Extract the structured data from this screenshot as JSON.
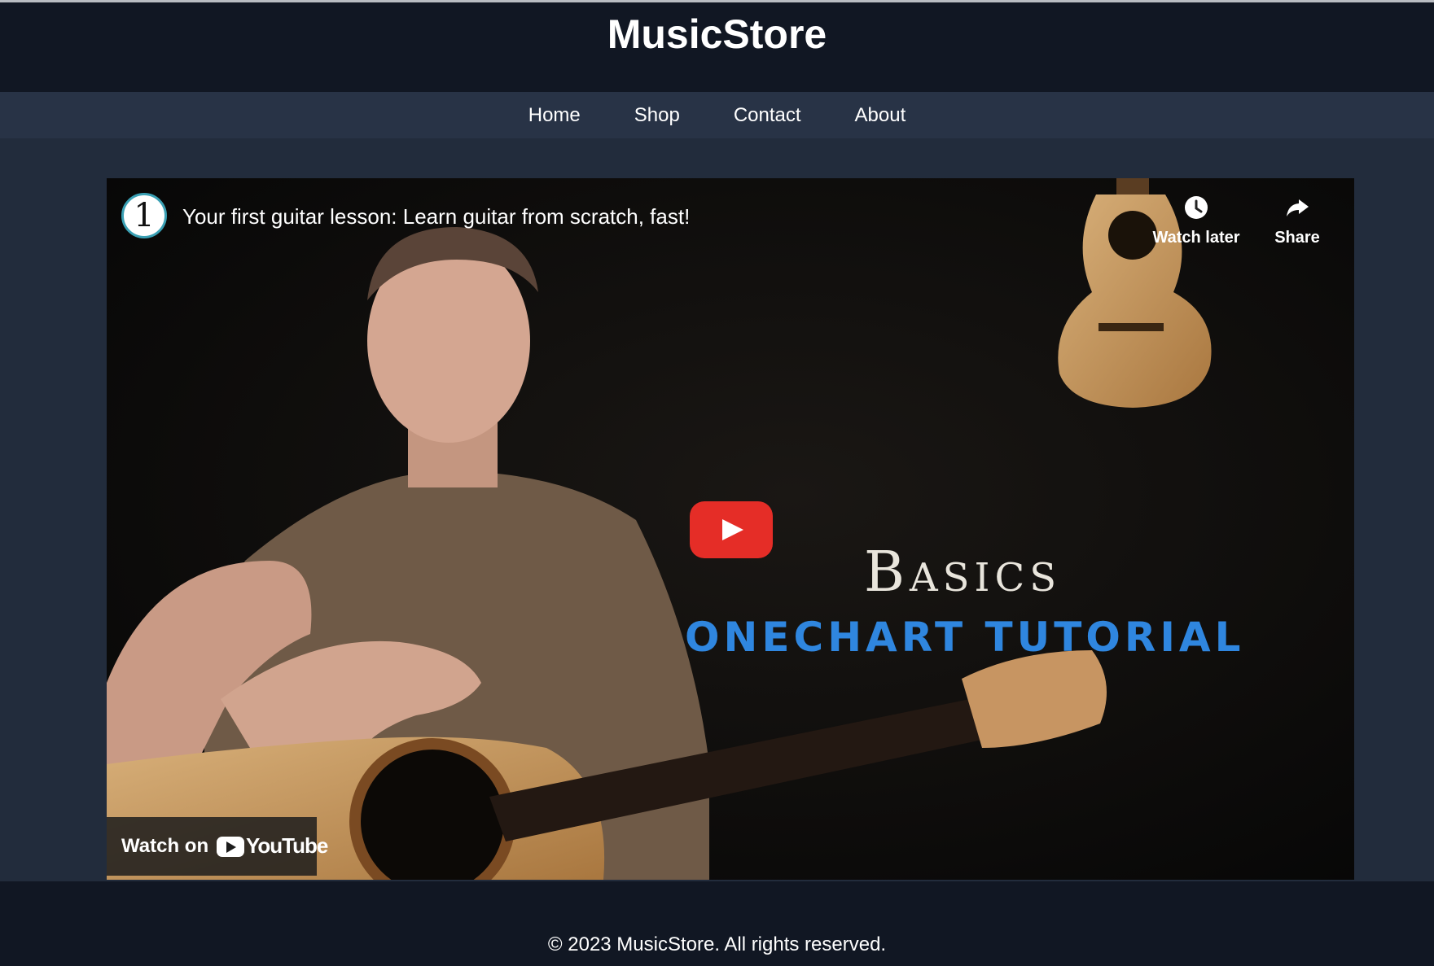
{
  "site": {
    "title": "MusicStore"
  },
  "nav": {
    "items": [
      "Home",
      "Shop",
      "Contact",
      "About"
    ]
  },
  "video": {
    "channel_logo_text": "1",
    "title": "Your first guitar lesson: Learn guitar from scratch, fast!",
    "watch_later_label": "Watch later",
    "share_label": "Share",
    "thumbnail_title": "Basics",
    "thumbnail_subtitle": "ONECHART TUTORIAL",
    "watch_on_label": "Watch on",
    "youtube_label": "YouTube",
    "icons": {
      "watch_later": "clock-icon",
      "share": "share-arrow-icon",
      "play": "play-icon"
    },
    "colors": {
      "play_button": "#e52d27",
      "subtitle": "#2f86df"
    }
  },
  "footer": {
    "copyright": "© 2023 MusicStore. All rights reserved."
  }
}
